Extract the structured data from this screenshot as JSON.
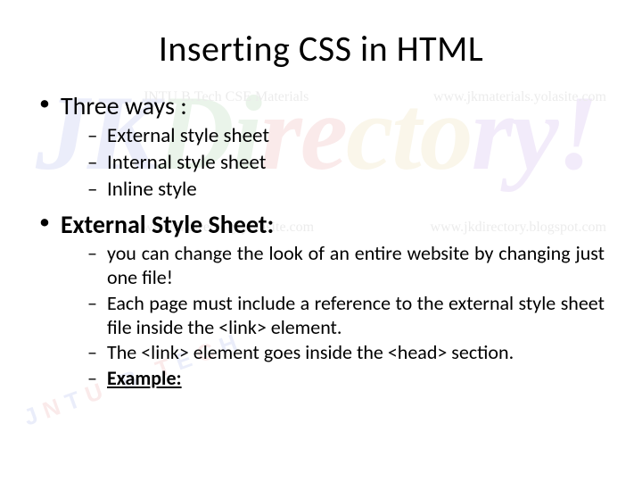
{
  "title": "Inserting CSS in HTML",
  "bullets": {
    "item1": {
      "head": "Three ways :",
      "sub": [
        "External style sheet",
        "Internal style sheet",
        "Inline style"
      ]
    },
    "item2": {
      "head": "External Style Sheet:",
      "sub": [
        "you can change the look of an entire website by changing just one file!",
        "Each page must include a reference to the external style sheet file inside the <link> element.",
        "The <link> element goes inside the <head> section."
      ],
      "example_label": "Example:"
    }
  },
  "watermark": {
    "logo_text": "JKDirectory!",
    "top_left": "JNTU B.Tech CSE Materials",
    "top_right": "www.jkmaterials.yolasite.com",
    "bottom_left": "www.jkdirectory.yolasite.com",
    "bottom_right": "www.jkdirectory.blogspot.com",
    "jntu": "JNTU B TECH"
  }
}
